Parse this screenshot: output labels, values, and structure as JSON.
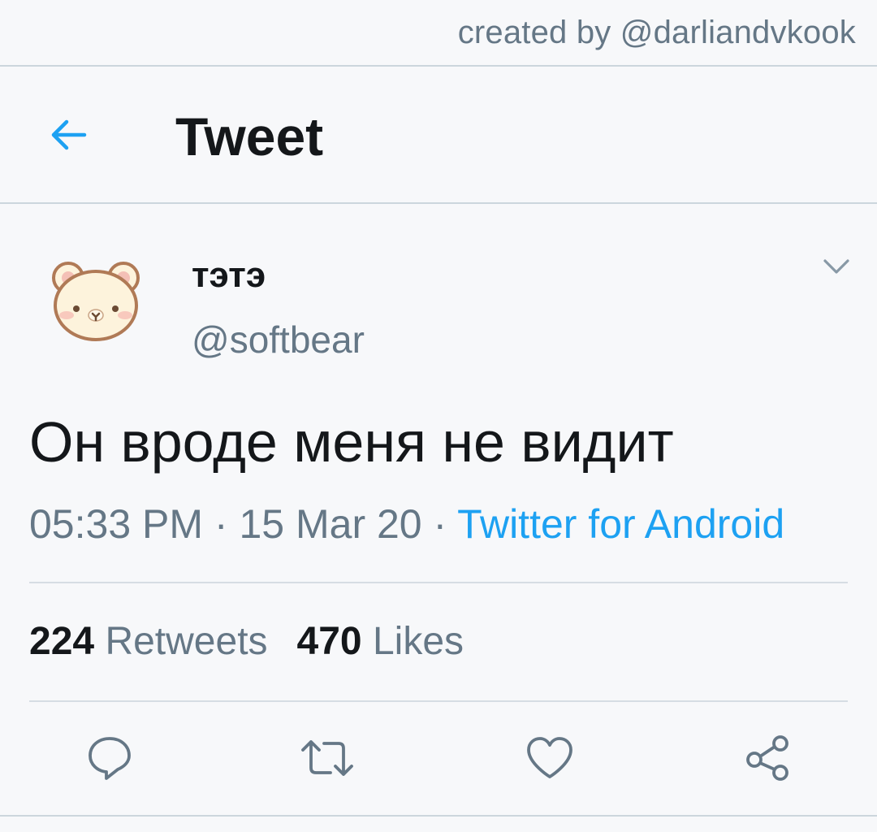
{
  "watermark": "created by @darliandvkook",
  "header": {
    "title": "Tweet",
    "back_icon": "arrow-left-icon"
  },
  "tweet": {
    "author": {
      "display_name": "тэтэ",
      "handle": "@softbear",
      "avatar": "bear-avatar"
    },
    "text": "Он вроде меня не видит",
    "time": "05:33 PM",
    "date": "15 Mar 20",
    "separator": "·",
    "source": "Twitter for Android",
    "retweets": {
      "count": "224",
      "label": "Retweets"
    },
    "likes": {
      "count": "470",
      "label": "Likes"
    }
  },
  "actions": [
    "reply-icon",
    "retweet-icon",
    "like-icon",
    "share-icon"
  ],
  "colors": {
    "accent": "#1da1f2",
    "secondary_text": "#657786",
    "primary_text": "#14171a",
    "background": "#f7f8fa"
  }
}
